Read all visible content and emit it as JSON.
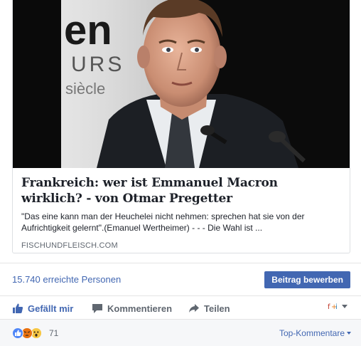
{
  "preview": {
    "image_banner_text": [
      "en",
      "URS",
      "siècle"
    ],
    "headline": "Frankreich: wer ist Emmanuel Macron wirklich? - von Otmar Pregetter",
    "excerpt": "\"Das eine kann man der Heuchelei nicht nehmen: sprechen hat sie von der Aufrichtigkeit gelernt\".(Emanuel Wertheimer) - - - Die Wahl ist ...",
    "domain": "FISCHUNDFLEISCH.COM"
  },
  "reach": {
    "text": "15.740 erreichte Personen",
    "boost_label": "Beitrag bewerben"
  },
  "actions": {
    "like": "Gefällt mir",
    "comment": "Kommentieren",
    "share": "Teilen"
  },
  "reactions": {
    "icons": [
      "like-icon",
      "angry-icon",
      "wow-icon"
    ],
    "count": "71",
    "sort_label": "Top-Kommentare"
  },
  "colors": {
    "link_blue": "#4267b2",
    "text": "#1d2129",
    "muted": "#606770",
    "footer_bg": "#f6f7f9"
  }
}
